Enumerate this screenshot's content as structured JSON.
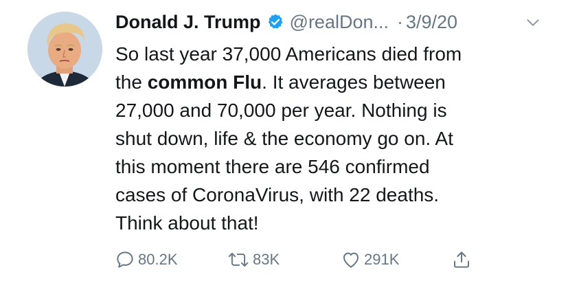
{
  "tweet": {
    "author_name": "Donald J. Trump",
    "handle": "@realDon...",
    "separator": "·",
    "date": "3/9/20",
    "text_lines": [
      {
        "pre": "So last year 37,000 Americans died from",
        "bold": "",
        "post": ""
      },
      {
        "pre": "the ",
        "bold": "common Flu",
        "post": ". It averages between"
      },
      {
        "pre": "27,000 and 70,000 per year. Nothing is",
        "bold": "",
        "post": ""
      },
      {
        "pre": "shut down, life & the economy go on. At",
        "bold": "",
        "post": ""
      },
      {
        "pre": "this moment there are 546 confirmed",
        "bold": "",
        "post": ""
      },
      {
        "pre": "cases of CoronaVirus, with 22 deaths.",
        "bold": "",
        "post": ""
      },
      {
        "pre": "Think about that!",
        "bold": "",
        "post": ""
      }
    ],
    "stats": {
      "replies": "80.2K",
      "retweets": "83K",
      "likes": "291K"
    },
    "icons": {
      "verified": "verified-badge-icon",
      "more": "chevron-down-icon",
      "reply": "reply-icon",
      "retweet": "retweet-icon",
      "like": "heart-icon",
      "share": "share-icon"
    }
  },
  "colors": {
    "text": "#14171a",
    "muted": "#657786",
    "verified": "#1da1f2"
  }
}
